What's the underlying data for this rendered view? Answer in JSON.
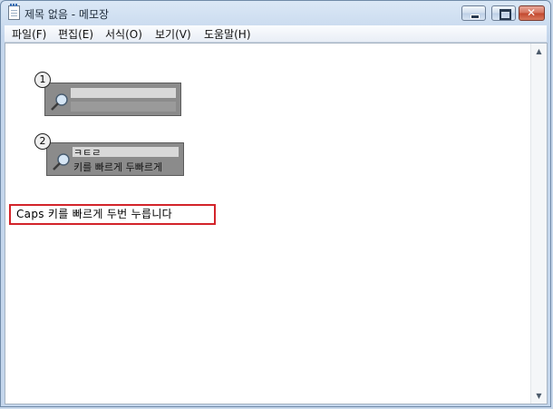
{
  "window": {
    "title": "제목 없음 - 메모장"
  },
  "menu": {
    "items": [
      "파일(F)",
      "편집(E)",
      "서식(O)",
      "보기(V)",
      "도움말(H)"
    ]
  },
  "callouts": [
    {
      "number": "1",
      "top_text": "",
      "bottom_text": ""
    },
    {
      "number": "2",
      "top_text": "ㅋㅌㄹ",
      "bottom_text": "키를 빠르게 두빠르게"
    }
  ],
  "annotation": {
    "text": "Caps 키를 빠르게 두번 누릅니다"
  },
  "scrollbar": {
    "up_arrow": "▲",
    "down_arrow": "▼"
  },
  "titlebar_buttons": {
    "close_glyph": "✕"
  },
  "icons": [
    "notepad-icon",
    "minimize-icon",
    "maximize-icon",
    "close-icon",
    "magnifier-icon"
  ]
}
